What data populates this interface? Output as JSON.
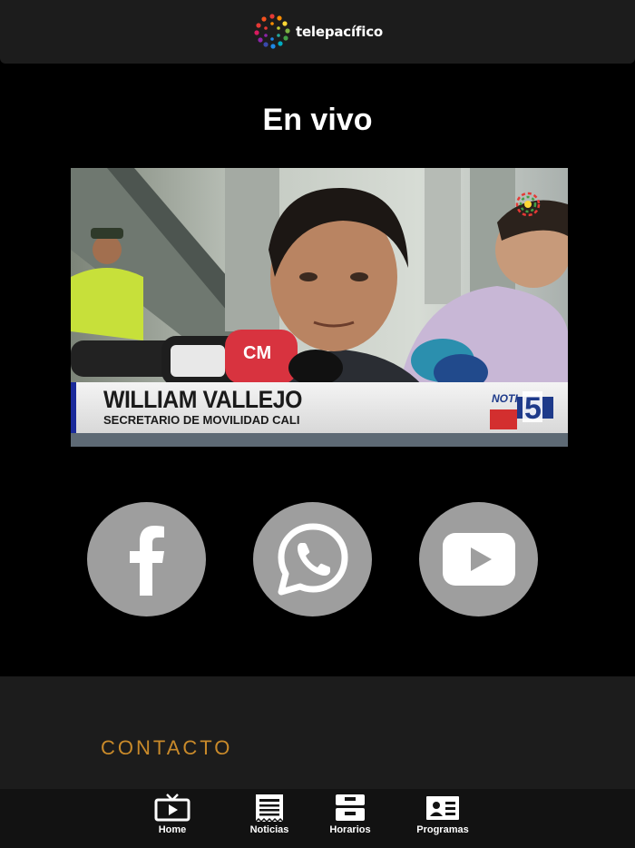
{
  "header": {
    "brand_name": "telepacífico"
  },
  "live": {
    "title": "En vivo",
    "video": {
      "lower_third_name": "WILLIAM VALLEJO",
      "lower_third_role": "SECRETARIO DE MOVILIDAD CALI",
      "mic_flag_text": "CM"
    }
  },
  "social": {
    "items": [
      {
        "icon": "facebook-icon"
      },
      {
        "icon": "whatsapp-icon"
      },
      {
        "icon": "youtube-icon"
      }
    ]
  },
  "footer": {
    "contact_title": "CONTACTO"
  },
  "bottom_nav": {
    "items": [
      {
        "label": "Home",
        "icon": "tv-icon"
      },
      {
        "label": "Noticias",
        "icon": "newspaper-icon"
      },
      {
        "label": "Horarios",
        "icon": "schedule-icon"
      },
      {
        "label": "Programas",
        "icon": "programs-icon"
      }
    ]
  },
  "colors": {
    "header_bg": "#1c1c1c",
    "page_bg": "#000000",
    "social_button": "#9e9e9e",
    "contact_accent": "#c98a2a",
    "nav_bg": "#121212"
  }
}
